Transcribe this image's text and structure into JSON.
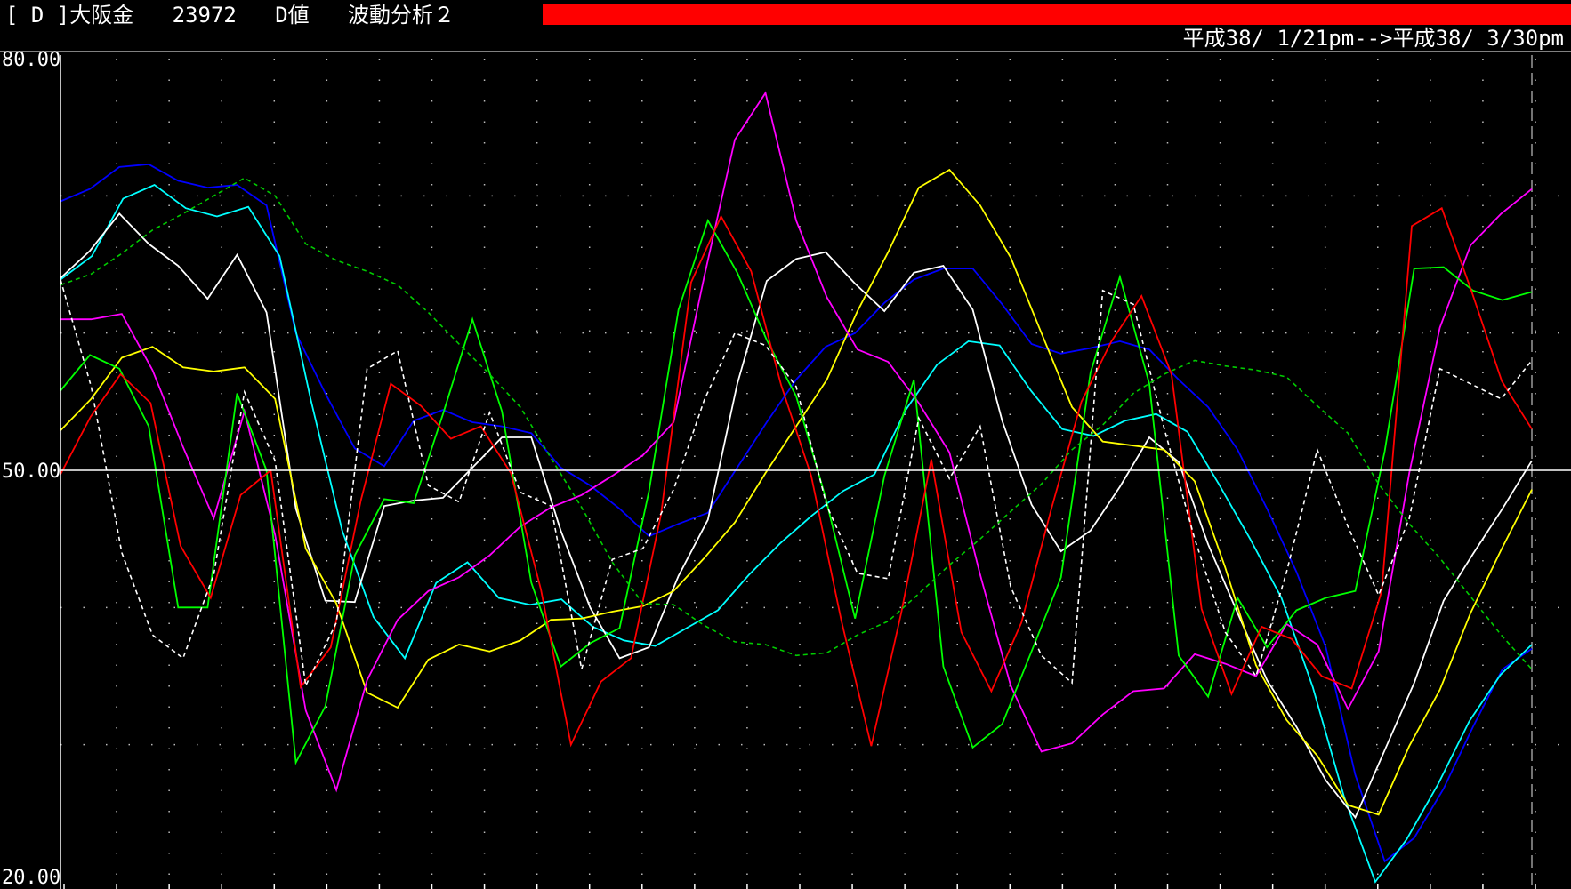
{
  "header": {
    "code_bracket": "[ D ]",
    "instrument": "大阪金",
    "number": "23972",
    "mode": "D値",
    "analysis": "波動分析２",
    "date_range": "平成38/ 1/21pm-->平成38/ 3/30pm",
    "bar_color": "#ff0000"
  },
  "chart_data": {
    "type": "line",
    "ylim": [
      20,
      80
    ],
    "yticks": [
      {
        "value": 80,
        "label": "80.00"
      },
      {
        "value": 50,
        "label": "50.00"
      },
      {
        "value": 20,
        "label": "20.00"
      }
    ],
    "grid": true,
    "reference_value": 50,
    "series": [
      {
        "color": "#0000ff",
        "dashed": false,
        "values": [
          69.6,
          70.5,
          72.1,
          72.3,
          71.1,
          70.6,
          70.8,
          69.3,
          60.0,
          55.6,
          51.6,
          50.3,
          53.6,
          54.4,
          53.5,
          53.2,
          52.7,
          50.2,
          48.9,
          47.2,
          45.2,
          46.1,
          46.9,
          50.2,
          53.5,
          56.6,
          59.0,
          60.0,
          62.2,
          63.9,
          64.7,
          64.7,
          62.1,
          59.2,
          58.5,
          58.9,
          59.4,
          58.8,
          56.6,
          54.6,
          51.5,
          47.2,
          42.6,
          37.1,
          27.8,
          21.5,
          23.2,
          26.8,
          31.3,
          35.5,
          37.0
        ]
      },
      {
        "color": "#00ffff",
        "dashed": false,
        "values": [
          63.9,
          65.6,
          69.8,
          70.8,
          69.1,
          68.5,
          69.2,
          65.6,
          55.1,
          45.6,
          39.3,
          36.3,
          41.8,
          43.3,
          40.7,
          40.2,
          40.6,
          38.6,
          37.6,
          37.2,
          38.5,
          39.8,
          42.4,
          44.7,
          46.7,
          48.5,
          49.7,
          54.4,
          57.7,
          59.4,
          59.1,
          55.8,
          53.0,
          52.5,
          53.6,
          54.1,
          52.8,
          49.0,
          45.0,
          40.7,
          34.2,
          26.2,
          20.0,
          23.1,
          27.1,
          31.7,
          35.1,
          37.3
        ]
      },
      {
        "color": "#ffffff",
        "dashed": false,
        "values": [
          64.0,
          66.0,
          68.7,
          66.5,
          64.9,
          62.5,
          65.7,
          61.5,
          47.2,
          40.5,
          40.4,
          47.4,
          47.8,
          48.0,
          50.2,
          52.4,
          52.4,
          45.6,
          40.0,
          36.3,
          37.1,
          42.3,
          46.4,
          56.3,
          63.8,
          65.4,
          65.9,
          63.6,
          61.6,
          64.4,
          64.9,
          61.7,
          53.6,
          47.5,
          44.1,
          45.6,
          48.8,
          52.4,
          50.6,
          44.6,
          39.6,
          34.7,
          31.3,
          27.4,
          24.7,
          29.6,
          34.5,
          40.5,
          43.9,
          47.2,
          50.7
        ]
      },
      {
        "color": "#ffff00",
        "dashed": false,
        "values": [
          52.9,
          55.2,
          58.2,
          59.0,
          57.5,
          57.2,
          57.5,
          55.2,
          44.3,
          40.3,
          33.8,
          32.7,
          36.2,
          37.3,
          36.8,
          37.6,
          39.1,
          39.2,
          39.7,
          40.1,
          41.2,
          43.6,
          46.2,
          49.8,
          53.2,
          56.6,
          61.6,
          65.9,
          70.6,
          71.9,
          69.3,
          65.5,
          60.0,
          54.6,
          52.1,
          51.8,
          51.5,
          49.2,
          42.9,
          35.8,
          31.8,
          29.2,
          25.6,
          24.9,
          29.9,
          34.0,
          39.6,
          44.2,
          48.6
        ]
      },
      {
        "color": "#ff00ff",
        "dashed": false,
        "values": [
          61.0,
          61.0,
          61.4,
          57.3,
          51.7,
          46.5,
          54.3,
          45.3,
          32.5,
          26.7,
          34.7,
          39.1,
          41.2,
          42.2,
          43.8,
          45.9,
          47.3,
          48.2,
          49.6,
          51.1,
          53.5,
          64.1,
          74.1,
          77.5,
          68.2,
          62.6,
          58.8,
          57.9,
          54.9,
          51.3,
          42.4,
          34.3,
          29.5,
          30.1,
          32.2,
          33.9,
          34.1,
          36.6,
          35.9,
          35.0,
          38.8,
          37.3,
          32.6,
          36.8,
          49.8,
          60.4,
          66.4,
          68.7,
          70.5
        ]
      },
      {
        "color": "#00ff00",
        "dashed": false,
        "values": [
          55.8,
          58.4,
          57.4,
          53.2,
          40.0,
          40.0,
          55.6,
          50.0,
          28.7,
          32.8,
          43.8,
          47.9,
          47.6,
          54.1,
          61.0,
          54.3,
          41.8,
          35.7,
          37.4,
          38.5,
          48.5,
          61.7,
          68.2,
          64.4,
          59.5,
          55.4,
          48.0,
          39.2,
          49.6,
          56.6,
          35.7,
          29.8,
          31.5,
          36.8,
          42.2,
          57.1,
          64.1,
          56.3,
          36.5,
          33.5,
          40.7,
          37.1,
          39.8,
          40.7,
          41.2,
          51.4,
          64.7,
          64.8,
          63.1,
          62.4,
          63.0
        ]
      },
      {
        "color": "#ff0000",
        "dashed": false,
        "values": [
          49.7,
          53.9,
          57.0,
          54.9,
          44.5,
          40.7,
          48.2,
          50.0,
          34.2,
          37.1,
          47.8,
          56.3,
          54.7,
          52.3,
          53.2,
          49.8,
          41.3,
          30.0,
          34.6,
          36.3,
          46.8,
          63.7,
          68.5,
          64.5,
          56.2,
          49.6,
          39.1,
          29.9,
          39.6,
          50.8,
          38.2,
          33.9,
          38.9,
          47.2,
          55.0,
          59.4,
          62.7,
          57.0,
          39.9,
          33.7,
          38.6,
          37.7,
          35.0,
          34.1,
          41.2,
          67.8,
          69.1,
          63.0,
          56.5,
          53.0
        ]
      },
      {
        "color": "#ffffff",
        "dashed": true,
        "values": [
          63.9,
          56.1,
          44.0,
          38.0,
          36.3,
          42.4,
          55.7,
          50.7,
          34.3,
          38.9,
          57.4,
          58.7,
          48.9,
          47.7,
          54.2,
          48.4,
          47.4,
          35.5,
          43.5,
          44.3,
          48.6,
          55.1,
          60.0,
          59.1,
          56.1,
          47.4,
          42.5,
          42.1,
          53.8,
          49.4,
          53.2,
          41.5,
          36.5,
          34.5,
          63.1,
          62.1,
          53.1,
          45.0,
          38.2,
          35.0,
          42.6,
          51.5,
          45.9,
          40.9,
          46.5,
          57.4,
          56.3,
          55.2,
          58.0
        ]
      },
      {
        "color": "#00cc00",
        "dashed": true,
        "values": [
          63.5,
          64.3,
          65.8,
          67.5,
          68.7,
          70.0,
          71.3,
          70.0,
          66.5,
          65.3,
          64.5,
          63.5,
          61.5,
          59.2,
          57.0,
          54.6,
          50.9,
          47.3,
          43.3,
          40.3,
          40.2,
          38.7,
          37.5,
          37.3,
          36.5,
          36.7,
          38.0,
          39.0,
          41.0,
          43.1,
          45.0,
          47.0,
          49.0,
          51.5,
          53.3,
          55.6,
          57.0,
          58.0,
          57.6,
          57.3,
          56.8,
          54.7,
          52.7,
          49.0,
          46.1,
          43.6,
          40.8,
          38.0,
          35.5
        ]
      }
    ]
  }
}
